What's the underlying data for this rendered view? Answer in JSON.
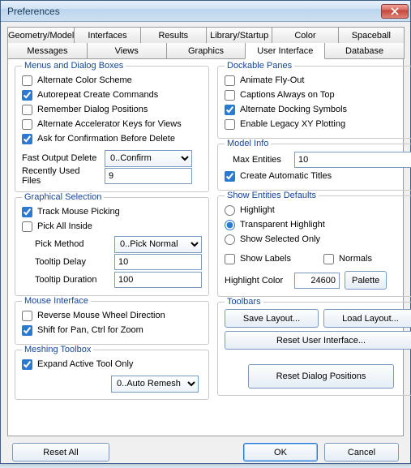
{
  "window": {
    "title": "Preferences"
  },
  "tabs_row1": [
    "Geometry/Model",
    "Interfaces",
    "Results",
    "Library/Startup",
    "Color",
    "Spaceball"
  ],
  "tabs_row2": [
    "Messages",
    "Views",
    "Graphics",
    "User Interface",
    "Database"
  ],
  "menus_group": {
    "title": "Menus and Dialog Boxes",
    "alt_color": "Alternate Color Scheme",
    "autorepeat": "Autorepeat Create Commands",
    "remember": "Remember Dialog Positions",
    "alt_accel": "Alternate Accelerator Keys for Views",
    "confirm_delete": "Ask for Confirmation Before Delete",
    "fast_output_label": "Fast Output Delete",
    "fast_output_value": "0..Confirm",
    "recent_label": "Recently Used Files",
    "recent_value": "9"
  },
  "gsel_group": {
    "title": "Graphical Selection",
    "track": "Track Mouse Picking",
    "pick_all": "Pick All Inside",
    "method_label": "Pick Method",
    "method_value": "0..Pick Normal",
    "tip_delay_label": "Tooltip Delay",
    "tip_delay_value": "10",
    "tip_dur_label": "Tooltip Duration",
    "tip_dur_value": "100"
  },
  "mouse_group": {
    "title": "Mouse Interface",
    "reverse": "Reverse Mouse Wheel Direction",
    "shift_pan": "Shift for Pan, Ctrl for Zoom"
  },
  "mesh_group": {
    "title": "Meshing Toolbox",
    "expand": "Expand Active Tool Only",
    "remesh_value": "0..Auto Remesh"
  },
  "dock_group": {
    "title": "Dockable Panes",
    "animate": "Animate Fly-Out",
    "captions": "Captions Always on Top",
    "alt_dock": "Alternate Docking Symbols",
    "legacy_xy": "Enable Legacy XY Plotting"
  },
  "model_group": {
    "title": "Model Info",
    "max_ent_label": "Max Entities",
    "max_ent_value": "10",
    "auto_titles": "Create Automatic Titles"
  },
  "show_group": {
    "title": "Show Entities Defaults",
    "highlight": "Highlight",
    "transparent": "Transparent Highlight",
    "selected_only": "Show Selected Only",
    "show_labels": "Show Labels",
    "normals": "Normals",
    "color_label": "Highlight Color",
    "color_value": "24600",
    "palette": "Palette"
  },
  "toolbars_group": {
    "title": "Toolbars",
    "save": "Save Layout...",
    "load": "Load Layout...",
    "reset_ui": "Reset User Interface...",
    "reset_dlg": "Reset Dialog Positions"
  },
  "bottom": {
    "reset_all": "Reset All",
    "ok": "OK",
    "cancel": "Cancel"
  }
}
